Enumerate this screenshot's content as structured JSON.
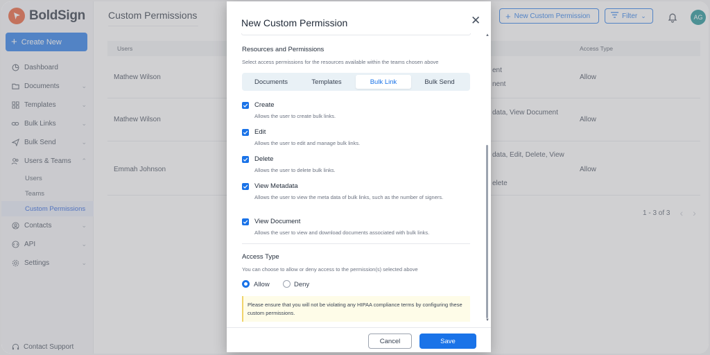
{
  "brand": {
    "name": "BoldSign",
    "accent": "#1a73e8",
    "logo_color": "#e8542b"
  },
  "sidebar": {
    "create_label": "Create New",
    "items": [
      {
        "label": "Dashboard",
        "icon": "dashboard-icon"
      },
      {
        "label": "Documents",
        "icon": "folder-icon"
      },
      {
        "label": "Templates",
        "icon": "grid-icon"
      },
      {
        "label": "Bulk Links",
        "icon": "link-icon"
      },
      {
        "label": "Bulk Send",
        "icon": "send-icon"
      },
      {
        "label": "Users & Teams",
        "icon": "users-icon"
      },
      {
        "label": "Contacts",
        "icon": "contact-icon"
      },
      {
        "label": "API",
        "icon": "api-icon"
      },
      {
        "label": "Settings",
        "icon": "gear-icon"
      }
    ],
    "sub_items": [
      "Users",
      "Teams",
      "Custom Permissions"
    ],
    "contact_support": "Contact Support"
  },
  "header": {
    "title": "Custom Permissions",
    "new_button": "New Custom Permission",
    "filter_button": "Filter",
    "avatar_initials": "AG"
  },
  "table": {
    "headers": {
      "users": "Users",
      "access": "Access Type"
    },
    "rows": [
      {
        "user": "Mathew Wilson",
        "perm1": "ent",
        "perm2": "nent",
        "access": "Allow"
      },
      {
        "user": "Mathew Wilson",
        "perm1": "data, View Document",
        "access": "Allow"
      },
      {
        "user": "Emmah Johnson",
        "perm1": "data, Edit, Delete, View",
        "perm2": "elete",
        "access": "Allow"
      }
    ],
    "pager_text": "1 - 3 of 3"
  },
  "modal": {
    "title": "New Custom Permission",
    "resources_title": "Resources and Permissions",
    "resources_desc": "Select access permissions for the resources available within the teams chosen above",
    "tabs": [
      "Documents",
      "Templates",
      "Bulk Link",
      "Bulk Send"
    ],
    "active_tab": "Bulk Link",
    "permissions": [
      {
        "label": "Create",
        "desc": "Allows the user to create bulk links.",
        "checked": true
      },
      {
        "label": "Edit",
        "desc": "Allows the user to edit and manage bulk links.",
        "checked": true
      },
      {
        "label": "Delete",
        "desc": "Allows the user to delete bulk links.",
        "checked": true
      },
      {
        "label": "View Metadata",
        "desc": "Allows the user to view the meta data of bulk links, such as the number of signers.",
        "checked": true
      },
      {
        "label": "View Document",
        "desc": "Allows the user to view and download documents associated with bulk links.",
        "checked": true
      }
    ],
    "access_title": "Access Type",
    "access_desc": "You can choose to allow or deny access to the permission(s) selected above",
    "access_options": [
      "Allow",
      "Deny"
    ],
    "access_selected": "Allow",
    "notice": "Please ensure that you will not be violating any HIPAA compliance terms by configuring these custom permissions.",
    "cancel_label": "Cancel",
    "save_label": "Save"
  }
}
